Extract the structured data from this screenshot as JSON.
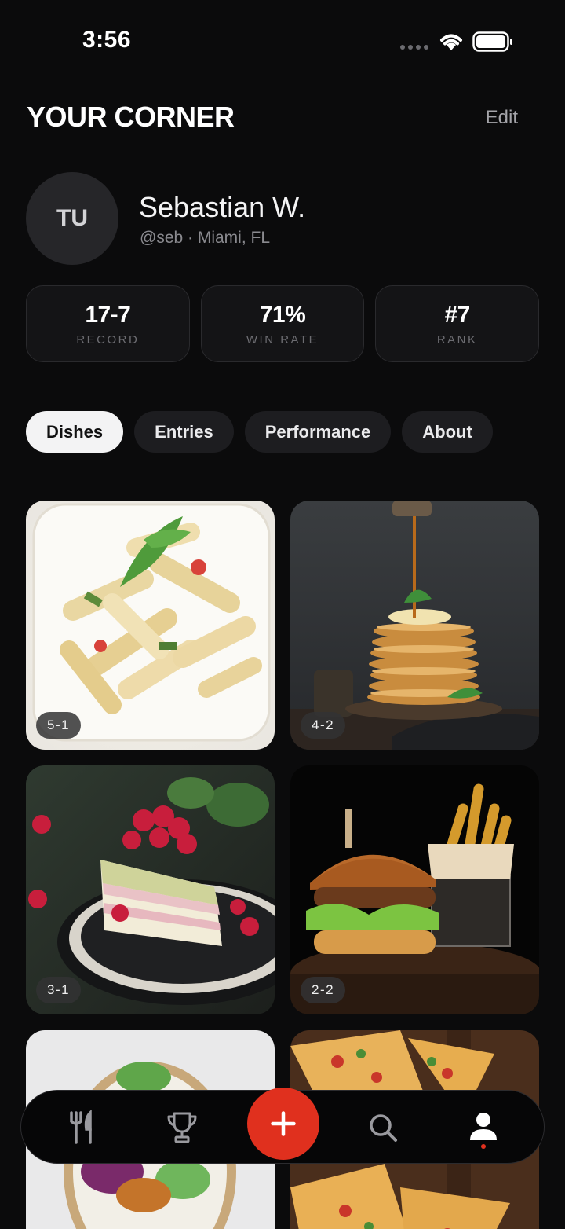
{
  "status_bar": {
    "time": "3:56"
  },
  "header": {
    "title": "YOUR CORNER",
    "edit_label": "Edit"
  },
  "profile": {
    "initials": "TU",
    "name": "Sebastian W.",
    "meta": "@seb · Miami, FL"
  },
  "stats": [
    {
      "value": "17-7",
      "label": "RECORD"
    },
    {
      "value": "71%",
      "label": "WIN RATE"
    },
    {
      "value": "#7",
      "label": "RANK"
    }
  ],
  "tabs": [
    {
      "label": "Dishes",
      "active": true
    },
    {
      "label": "Entries"
    },
    {
      "label": "Performance"
    },
    {
      "label": "About"
    }
  ],
  "dishes": [
    {
      "photo": "penne pasta",
      "score": "5-1"
    },
    {
      "photo": "pancake stack",
      "score": "4-2"
    },
    {
      "photo": "raspberry cake slice",
      "score": "3-1"
    },
    {
      "photo": "burger and fries",
      "score": "2-2"
    },
    {
      "photo": "salad bowl",
      "score": ""
    },
    {
      "photo": "pizza",
      "score": ""
    }
  ],
  "nav": {
    "items": [
      "utensils-icon",
      "trophy-icon",
      "add-icon",
      "search-icon",
      "profile-icon"
    ],
    "active": "profile-icon",
    "accent": "#e0301e"
  }
}
